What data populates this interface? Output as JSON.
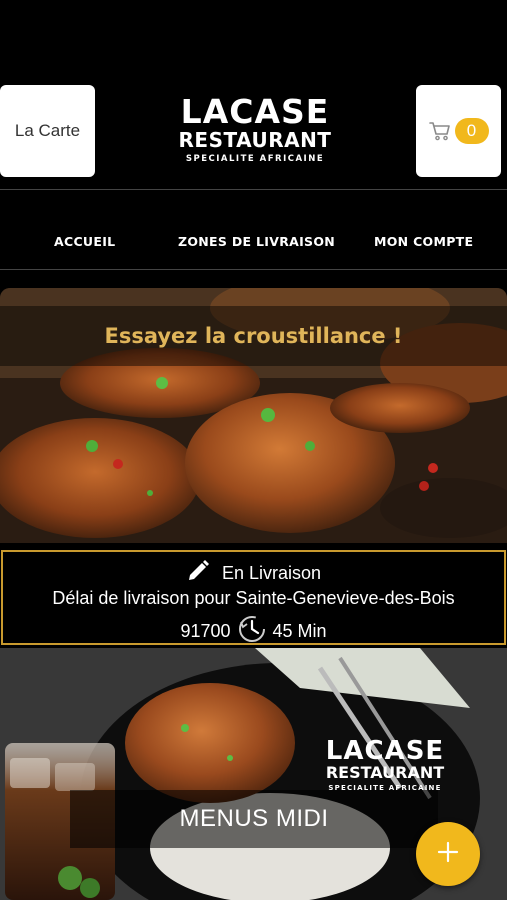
{
  "header": {
    "carte_label": "La Carte",
    "logo": {
      "line1": "LACASE",
      "line2": "RESTAURANT",
      "line3": "SPECIALITE AFRICAINE"
    },
    "cart_count": "0"
  },
  "nav": {
    "items": [
      {
        "label": "ACCUEIL"
      },
      {
        "label": "ZONES DE LIVRAISON"
      },
      {
        "label": "MON COMPTE"
      }
    ]
  },
  "hero": {
    "title": "Essayez la croustillance !"
  },
  "delivery": {
    "mode": "En Livraison",
    "delay_text": "Délai de livraison pour Sainte-Genevieve-des-Bois",
    "postal_code": "91700",
    "duration": "45 Min"
  },
  "menu_card": {
    "logo": {
      "line1": "LACASE",
      "line2": "RESTAURANT",
      "line3": "SPECIALITE AFRICAINE"
    },
    "label": "MENUS MIDI"
  },
  "fab": {
    "icon": "plus-icon"
  },
  "colors": {
    "accent": "#f1b81c",
    "hero_title": "#e0b55a",
    "border_gold": "#c99a2e",
    "background": "#000000"
  }
}
